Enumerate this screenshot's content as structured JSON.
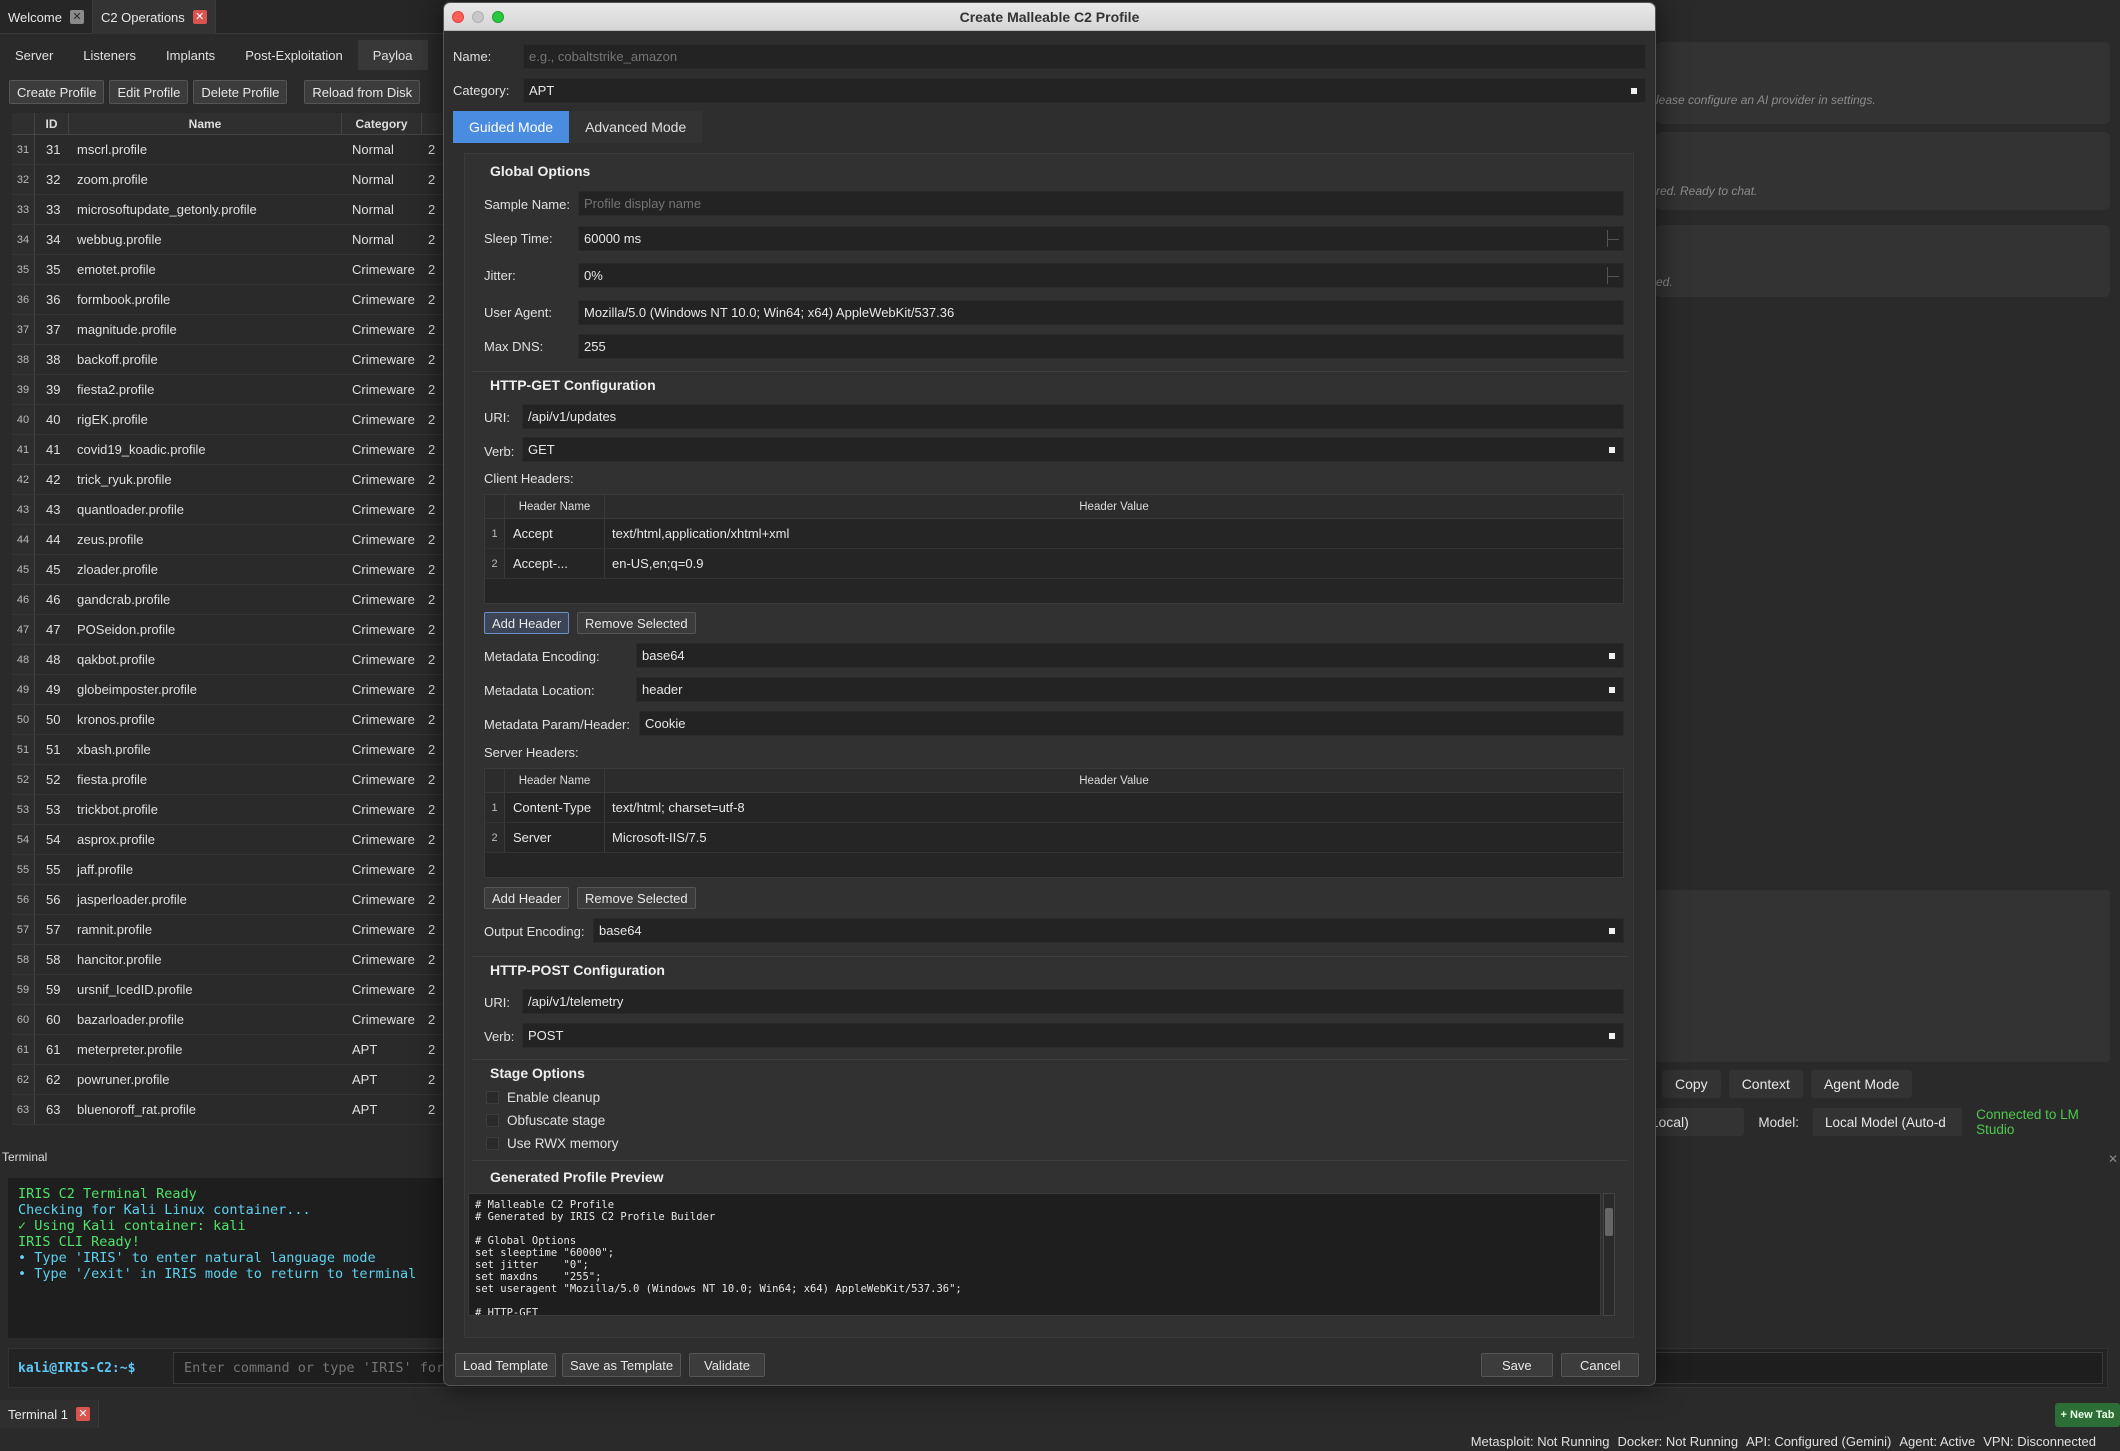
{
  "top_tabs": [
    {
      "label": "Welcome",
      "active": false
    },
    {
      "label": "C2 Operations",
      "active": true
    }
  ],
  "sub_tabs": [
    "Server",
    "Listeners",
    "Implants",
    "Post-Exploitation",
    "Payloa"
  ],
  "toolbar": {
    "create_profile": "Create Profile",
    "edit_profile": "Edit Profile",
    "delete_profile": "Delete Profile",
    "reload": "Reload from Disk"
  },
  "profiles_table": {
    "headers": [
      "ID",
      "Name",
      "Category"
    ],
    "rows": [
      {
        "rn": "31",
        "id": "31",
        "name": "mscrl.profile",
        "category": "Normal",
        "more": "2"
      },
      {
        "rn": "32",
        "id": "32",
        "name": "zoom.profile",
        "category": "Normal",
        "more": "2"
      },
      {
        "rn": "33",
        "id": "33",
        "name": "microsoftupdate_getonly.profile",
        "category": "Normal",
        "more": "2"
      },
      {
        "rn": "34",
        "id": "34",
        "name": "webbug.profile",
        "category": "Normal",
        "more": "2"
      },
      {
        "rn": "35",
        "id": "35",
        "name": "emotet.profile",
        "category": "Crimeware",
        "more": "2"
      },
      {
        "rn": "36",
        "id": "36",
        "name": "formbook.profile",
        "category": "Crimeware",
        "more": "2"
      },
      {
        "rn": "37",
        "id": "37",
        "name": "magnitude.profile",
        "category": "Crimeware",
        "more": "2"
      },
      {
        "rn": "38",
        "id": "38",
        "name": "backoff.profile",
        "category": "Crimeware",
        "more": "2"
      },
      {
        "rn": "39",
        "id": "39",
        "name": "fiesta2.profile",
        "category": "Crimeware",
        "more": "2"
      },
      {
        "rn": "40",
        "id": "40",
        "name": "rigEK.profile",
        "category": "Crimeware",
        "more": "2"
      },
      {
        "rn": "41",
        "id": "41",
        "name": "covid19_koadic.profile",
        "category": "Crimeware",
        "more": "2"
      },
      {
        "rn": "42",
        "id": "42",
        "name": "trick_ryuk.profile",
        "category": "Crimeware",
        "more": "2"
      },
      {
        "rn": "43",
        "id": "43",
        "name": "quantloader.profile",
        "category": "Crimeware",
        "more": "2"
      },
      {
        "rn": "44",
        "id": "44",
        "name": "zeus.profile",
        "category": "Crimeware",
        "more": "2"
      },
      {
        "rn": "45",
        "id": "45",
        "name": "zloader.profile",
        "category": "Crimeware",
        "more": "2"
      },
      {
        "rn": "46",
        "id": "46",
        "name": "gandcrab.profile",
        "category": "Crimeware",
        "more": "2"
      },
      {
        "rn": "47",
        "id": "47",
        "name": "POSeidon.profile",
        "category": "Crimeware",
        "more": "2"
      },
      {
        "rn": "48",
        "id": "48",
        "name": "qakbot.profile",
        "category": "Crimeware",
        "more": "2"
      },
      {
        "rn": "49",
        "id": "49",
        "name": "globeimposter.profile",
        "category": "Crimeware",
        "more": "2"
      },
      {
        "rn": "50",
        "id": "50",
        "name": "kronos.profile",
        "category": "Crimeware",
        "more": "2"
      },
      {
        "rn": "51",
        "id": "51",
        "name": "xbash.profile",
        "category": "Crimeware",
        "more": "2"
      },
      {
        "rn": "52",
        "id": "52",
        "name": "fiesta.profile",
        "category": "Crimeware",
        "more": "2"
      },
      {
        "rn": "53",
        "id": "53",
        "name": "trickbot.profile",
        "category": "Crimeware",
        "more": "2"
      },
      {
        "rn": "54",
        "id": "54",
        "name": "asprox.profile",
        "category": "Crimeware",
        "more": "2"
      },
      {
        "rn": "55",
        "id": "55",
        "name": "jaff.profile",
        "category": "Crimeware",
        "more": "2"
      },
      {
        "rn": "56",
        "id": "56",
        "name": "jasperloader.profile",
        "category": "Crimeware",
        "more": "2"
      },
      {
        "rn": "57",
        "id": "57",
        "name": "ramnit.profile",
        "category": "Crimeware",
        "more": "2"
      },
      {
        "rn": "58",
        "id": "58",
        "name": "hancitor.profile",
        "category": "Crimeware",
        "more": "2"
      },
      {
        "rn": "59",
        "id": "59",
        "name": "ursnif_IcedID.profile",
        "category": "Crimeware",
        "more": "2"
      },
      {
        "rn": "60",
        "id": "60",
        "name": "bazarloader.profile",
        "category": "Crimeware",
        "more": "2"
      },
      {
        "rn": "61",
        "id": "61",
        "name": "meterpreter.profile",
        "category": "APT",
        "more": "2"
      },
      {
        "rn": "62",
        "id": "62",
        "name": "powruner.profile",
        "category": "APT",
        "more": "2"
      },
      {
        "rn": "63",
        "id": "63",
        "name": "bluenoroff_rat.profile",
        "category": "APT",
        "more": "2"
      }
    ]
  },
  "terminal": {
    "label": "Terminal",
    "lines": [
      {
        "text": "IRIS C2 Terminal Ready",
        "color": "green"
      },
      {
        "text": "Checking for Kali Linux container...",
        "color": "cyan"
      },
      {
        "text": "✓ Using Kali container: kali",
        "color": "green"
      },
      {
        "text": "IRIS CLI Ready!",
        "color": "green"
      },
      {
        "text": "• Type 'IRIS' to enter natural language mode",
        "color": "cyan"
      },
      {
        "text": "• Type '/exit' in IRIS mode to return to terminal",
        "color": "cyan"
      }
    ],
    "prompt": "kali@IRIS-C2:~$",
    "input_placeholder": "Enter command or type 'IRIS' for",
    "tab_label": "Terminal 1",
    "new_tab": "+ New Tab"
  },
  "ai_panel": {
    "msg1": "lease configure an AI provider in settings.",
    "msg2": "red. Ready to chat.",
    "msg3": "ed.",
    "actions": [
      "Copy",
      "Context",
      "Agent Mode"
    ],
    "provider_fragment": "(Local)",
    "model_label": "Model:",
    "model_value": "Local Model (Auto-d",
    "connected": "Connected to LM Studio"
  },
  "status_bar": {
    "metasploit": "Metasploit: Not Running",
    "docker": "Docker: Not Running",
    "api": "API: Configured (Gemini)",
    "agent": "Agent: Active",
    "vpn": "VPN: Disconnected"
  },
  "modal": {
    "title": "Create Malleable C2 Profile",
    "name_label": "Name:",
    "name_placeholder": "e.g., cobaltstrike_amazon",
    "category_label": "Category:",
    "category_value": "APT",
    "mode_tabs": [
      "Guided Mode",
      "Advanced Mode"
    ],
    "global": {
      "title": "Global Options",
      "sample_name_label": "Sample Name:",
      "sample_name_placeholder": "Profile display name",
      "sleep_label": "Sleep Time:",
      "sleep_value": "60000 ms",
      "jitter_label": "Jitter:",
      "jitter_value": "0%",
      "ua_label": "User Agent:",
      "ua_value": "Mozilla/5.0 (Windows NT 10.0; Win64; x64) AppleWebKit/537.36",
      "dns_label": "Max DNS:",
      "dns_value": "255"
    },
    "http_get": {
      "title": "HTTP-GET Configuration",
      "uri_label": "URI:",
      "uri_value": "/api/v1/updates",
      "verb_label": "Verb:",
      "verb_value": "GET",
      "client_headers_label": "Client Headers:",
      "table_headers": [
        "Header Name",
        "Header Value"
      ],
      "client_headers": [
        {
          "rn": "1",
          "name": "Accept",
          "value": "text/html,application/xhtml+xml"
        },
        {
          "rn": "2",
          "name": "Accept-...",
          "value": "en-US,en;q=0.9"
        }
      ],
      "add_header": "Add Header",
      "remove_selected": "Remove Selected",
      "meta_enc_label": "Metadata Encoding:",
      "meta_enc_value": "base64",
      "meta_loc_label": "Metadata Location:",
      "meta_loc_value": "header",
      "meta_param_label": "Metadata Param/Header:",
      "meta_param_value": "Cookie",
      "server_headers_label": "Server Headers:",
      "server_headers": [
        {
          "rn": "1",
          "name": "Content-Type",
          "value": "text/html; charset=utf-8"
        },
        {
          "rn": "2",
          "name": "Server",
          "value": "Microsoft-IIS/7.5"
        }
      ],
      "output_enc_label": "Output Encoding:",
      "output_enc_value": "base64"
    },
    "http_post": {
      "title": "HTTP-POST Configuration",
      "uri_label": "URI:",
      "uri_value": "/api/v1/telemetry",
      "verb_label": "Verb:",
      "verb_value": "POST"
    },
    "stage": {
      "title": "Stage Options",
      "options": [
        "Enable cleanup",
        "Obfuscate stage",
        "Use RWX memory"
      ]
    },
    "preview": {
      "title": "Generated Profile Preview",
      "text": "# Malleable C2 Profile\n# Generated by IRIS C2 Profile Builder\n\n# Global Options\nset sleeptime \"60000\";\nset jitter    \"0\";\nset maxdns    \"255\";\nset useragent \"Mozilla/5.0 (Windows NT 10.0; Win64; x64) AppleWebKit/537.36\";\n\n# HTTP-GET"
    },
    "footer": {
      "load_template": "Load Template",
      "save_template": "Save as Template",
      "validate": "Validate",
      "save": "Save",
      "cancel": "Cancel"
    }
  }
}
